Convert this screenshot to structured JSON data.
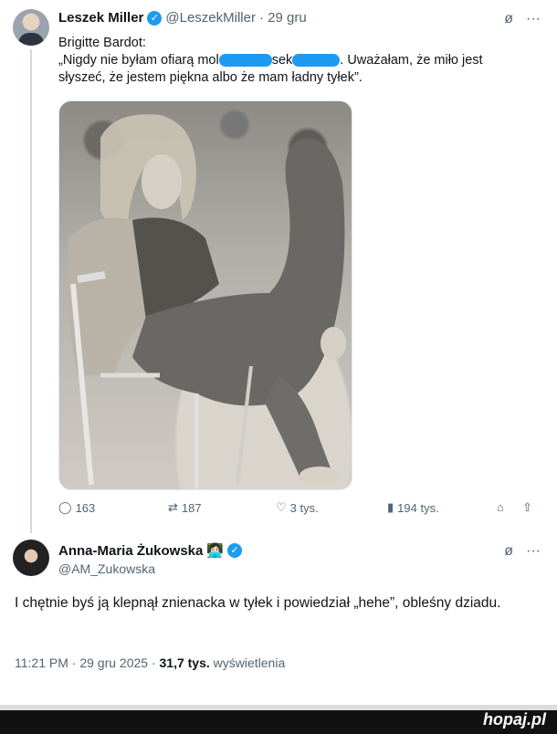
{
  "tweet": {
    "author_name": "Leszek Miller",
    "handle": "@LeszekMiller",
    "date": "· 29 gru",
    "text_line1_a": "Brigitte Bardot:",
    "text_line2_a": "„Nigdy nie byłam ofiarą mol",
    "text_line2_b": "sek",
    "text_line2_c": ". Uważałam, że miło jest",
    "text_line3": "słyszeć, że jestem piękna albo że mam ładny tyłek”.",
    "replies": "163",
    "retweets": "187",
    "likes": "3 tys.",
    "views": "194 tys."
  },
  "reply": {
    "author_name": "Anna-Maria Żukowska",
    "emoji": "👩🏻‍💻",
    "handle": "@AM_Zukowska",
    "text": "I chętnie byś ją klepnął znienacka w tyłek i powiedział „hehe”, obleśny dziadu.",
    "time": "11:21 PM · 29 gru 2025 · ",
    "views_count": "31,7 tys.",
    "views_label": " wyświetlenia"
  },
  "watermark": "hopaj.pl",
  "icons": {
    "more": "more-icon",
    "grok": "grok-icon",
    "reply": "reply-icon",
    "retweet": "retweet-icon",
    "like": "like-icon",
    "views": "views-icon",
    "bookmark": "bookmark-icon",
    "share": "share-icon",
    "verified": "verified-icon"
  },
  "colors": {
    "accent": "#1d9bf0",
    "muted": "#536471",
    "text": "#0f1419"
  }
}
